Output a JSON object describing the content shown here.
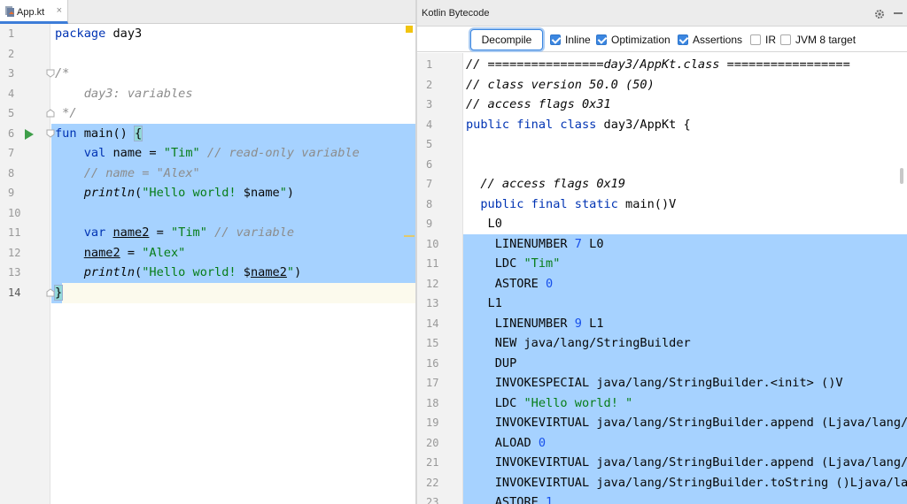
{
  "editor": {
    "tab_label": "App.kt",
    "tab_close": "×",
    "line_numbers": [
      "1",
      "2",
      "3",
      "4",
      "5",
      "6",
      "7",
      "8",
      "9",
      "10",
      "11",
      "12",
      "13",
      "14"
    ]
  },
  "code": {
    "l1_kw": "package",
    "l1_rest": " day3",
    "l3": "/*",
    "l4": "    day3: variables",
    "l5": " */",
    "l6_kw": "fun",
    "l6_fn": " main",
    "l6_paren": "() ",
    "l6_brace": "{",
    "l7_kw": "    val",
    "l7_name": " name = ",
    "l7_str": "\"Tim\"",
    "l7_cm": " // read-only variable",
    "l8": "    // name = \"Alex\"",
    "l9_fn": "    println",
    "l9_open": "(",
    "l9_str": "\"Hello world! ",
    "l9_var": "$name",
    "l9_strend": "\"",
    "l9_close": ")",
    "l11_kw": "    var",
    "l11_sp": " ",
    "l11_name": "name2",
    "l11_eq": " = ",
    "l11_str": "\"Tim\"",
    "l11_cm": " // variable",
    "l12_ind": "    ",
    "l12_name": "name2",
    "l12_eq": " = ",
    "l12_str": "\"Alex\"",
    "l13_fn": "    println",
    "l13_open": "(",
    "l13_str": "\"Hello world! ",
    "l13_dollar": "$",
    "l13_var": "name2",
    "l13_strend": "\"",
    "l13_close": ")",
    "l14": "}"
  },
  "bytecode_panel": {
    "title": "Kotlin Bytecode",
    "decompile_label": "Decompile",
    "options": [
      {
        "label": "Inline",
        "checked": true
      },
      {
        "label": "Optimization",
        "checked": true
      },
      {
        "label": "Assertions",
        "checked": true
      },
      {
        "label": "IR",
        "checked": false
      },
      {
        "label": "JVM 8 target",
        "checked": false
      }
    ],
    "line_numbers": [
      "1",
      "2",
      "3",
      "4",
      "5",
      "6",
      "7",
      "8",
      "9",
      "10",
      "11",
      "12",
      "13",
      "14",
      "15",
      "16",
      "17",
      "18",
      "19",
      "20",
      "21",
      "22",
      "23"
    ]
  },
  "bytecode": {
    "b1": "// ================day3/AppKt.class =================",
    "b2": "// class version 50.0 (50)",
    "b3": "// access flags 0x31",
    "b4_kw": "public final class",
    "b4_rest": " day3/AppKt {",
    "b7": "  // access flags 0x19",
    "b8_kw": "  public final static",
    "b8_rest": " main()V",
    "b9": "   L0",
    "b10_a": "    LINENUMBER ",
    "b10_n": "7",
    "b10_b": " L0",
    "b11_a": "    LDC ",
    "b11_s": "\"Tim\"",
    "b12_a": "    ASTORE ",
    "b12_n": "0",
    "b13": "   L1",
    "b14_a": "    LINENUMBER ",
    "b14_n": "9",
    "b14_b": " L1",
    "b15": "    NEW java/lang/StringBuilder",
    "b16": "    DUP",
    "b17": "    INVOKESPECIAL java/lang/StringBuilder.<init> ()V",
    "b18_a": "    LDC ",
    "b18_s": "\"Hello world! \"",
    "b19": "    INVOKEVIRTUAL java/lang/StringBuilder.append (Ljava/lang/String;)Ljava/lang/StringBuilder;",
    "b20_a": "    ALOAD ",
    "b20_n": "0",
    "b21": "    INVOKEVIRTUAL java/lang/StringBuilder.append (Ljava/lang/String;)Ljava/lang/StringBuilder;",
    "b22": "    INVOKEVIRTUAL java/lang/StringBuilder.toString ()Ljava/lang/String;",
    "b23_a": "    ASTORE ",
    "b23_n": "1"
  }
}
